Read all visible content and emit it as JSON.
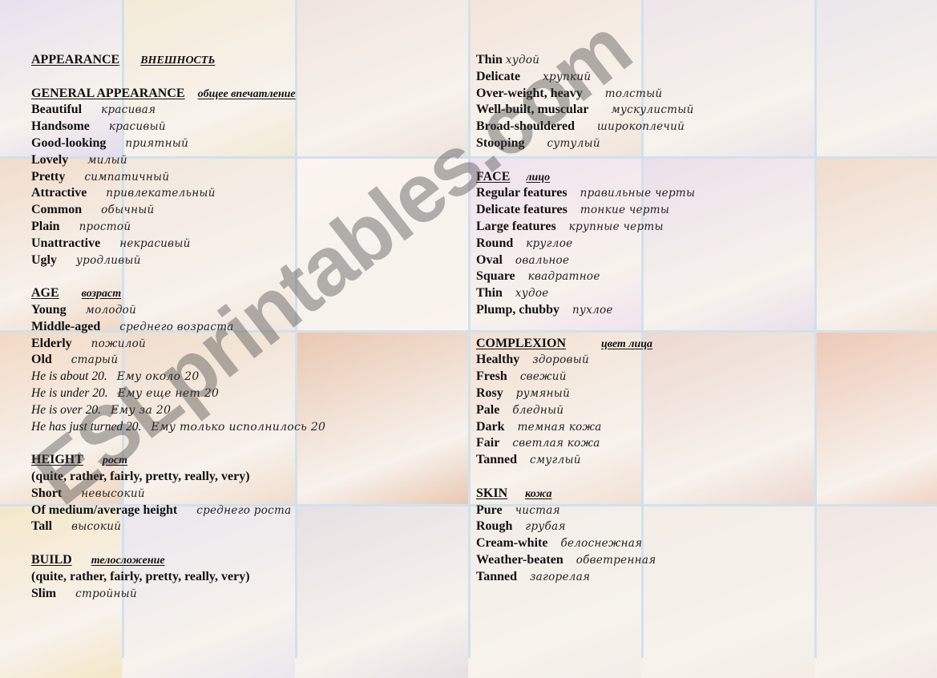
{
  "title": {
    "en": "APPEARANCE",
    "ru": "ВНЕШНОСТЬ"
  },
  "sections_left": [
    {
      "heading": {
        "en": "GENERAL APPEARANCE",
        "ru": "общее впечатление"
      },
      "items": [
        {
          "en": "Beautiful",
          "ru": "красивая"
        },
        {
          "en": "Handsome",
          "ru": "красивый"
        },
        {
          "en": "Good-looking",
          "ru": "приятный"
        },
        {
          "en": "Lovely",
          "ru": "милый"
        },
        {
          "en": "Pretty",
          "ru": "симпатичный"
        },
        {
          "en": "Attractive",
          "ru": "привлекательный"
        },
        {
          "en": "Common",
          "ru": "обычный"
        },
        {
          "en": "Plain",
          "ru": "простой"
        },
        {
          "en": "Unattractive",
          "ru": "некрасивый"
        },
        {
          "en": "Ugly",
          "ru": "уродливый"
        }
      ]
    },
    {
      "heading": {
        "en": "AGE",
        "ru": "возраст"
      },
      "items": [
        {
          "en": "Young",
          "ru": "молодой"
        },
        {
          "en": "Middle-aged",
          "ru": "среднего возраста"
        },
        {
          "en": "Elderly",
          "ru": "пожилой"
        },
        {
          "en": "Old",
          "ru": "старый"
        }
      ],
      "sentences": [
        {
          "en": "He is about 20.",
          "ru": "Ему около 20"
        },
        {
          "en": "He is under 20.",
          "ru": "Ему еще нет 20"
        },
        {
          "en": "He is over 20.",
          "ru": "Ему за 20"
        },
        {
          "en": "He has just turned 20.",
          "ru": "Ему только исполнилось 20"
        }
      ]
    },
    {
      "heading": {
        "en": "HEIGHT",
        "ru": "рост"
      },
      "note": "(quite, rather, fairly, pretty, really, very)",
      "items": [
        {
          "en": "Short",
          "ru": "невысокий"
        },
        {
          "en": "Of medium/average height",
          "ru": "среднего роста"
        },
        {
          "en": "Tall",
          "ru": "высокий"
        }
      ]
    },
    {
      "heading": {
        "en": "BUILD",
        "ru": "телосложение"
      },
      "note": "(quite, rather, fairly, pretty, really, very)",
      "items": [
        {
          "en": "Slim",
          "ru": "стройный"
        }
      ]
    }
  ],
  "build_continued": [
    {
      "en": "Thin",
      "ru": "худой"
    },
    {
      "en": "Delicate",
      "ru": "хрупкий"
    },
    {
      "en": "Over-weight, heavy",
      "ru": "толстый"
    },
    {
      "en": "Well-built, muscular",
      "ru": "мускулистый"
    },
    {
      "en": "Broad-shouldered",
      "ru": "широкоплечий"
    },
    {
      "en": "Stooping",
      "ru": "сутулый"
    }
  ],
  "sections_right": [
    {
      "heading": {
        "en": "FACE",
        "ru": "лицо"
      },
      "items": [
        {
          "en": "Regular features",
          "ru": "правильные черты"
        },
        {
          "en": "Delicate features",
          "ru": "тонкие черты"
        },
        {
          "en": "Large features",
          "ru": "крупные черты"
        },
        {
          "en": "Round",
          "ru": "круглое"
        },
        {
          "en": "Oval",
          "ru": "овальное"
        },
        {
          "en": "Square",
          "ru": "квадратное"
        },
        {
          "en": "Thin",
          "ru": "худое"
        },
        {
          "en": "Plump, chubby",
          "ru": "пухлое"
        }
      ]
    },
    {
      "heading": {
        "en": "COMPLEXION",
        "ru": "цвет лица"
      },
      "items": [
        {
          "en": "Healthy",
          "ru": "здоровый"
        },
        {
          "en": "Fresh",
          "ru": "свежий"
        },
        {
          "en": "Rosy",
          "ru": "румяный"
        },
        {
          "en": "Pale",
          "ru": "бледный"
        },
        {
          "en": "Dark",
          "ru": "темная кожа"
        },
        {
          "en": "Fair",
          "ru": "светлая кожа"
        },
        {
          "en": "Tanned",
          "ru": "смуглый"
        }
      ]
    },
    {
      "heading": {
        "en": "SKIN",
        "ru": "кожа"
      },
      "items": [
        {
          "en": "Pure",
          "ru": "чистая"
        },
        {
          "en": "Rough",
          "ru": "грубая"
        },
        {
          "en": "Cream-white",
          "ru": "белоснежная"
        },
        {
          "en": "Weather-beaten",
          "ru": "обветренная"
        },
        {
          "en": "Tanned",
          "ru": "загорелая"
        }
      ]
    }
  ],
  "watermark": "ESLprintables.com",
  "background_tile_colors": [
    "#e4dcef",
    "#f3ead4",
    "#efe3dc",
    "#f2e3d8",
    "#ece4e8",
    "#e9e5ea",
    "#f0d9c6",
    "#f2e7dd",
    "#fbf4f0",
    "#f0e2ee",
    "#eae0ea",
    "#f0dccd",
    "#f1d6bf",
    "#f0ddcb",
    "#e9c8b2",
    "#f2e0d2",
    "#ecd8d0",
    "#edc9b6",
    "#f4e6c5",
    "#eae6ee",
    "#e6e0e4",
    "#f2ede8",
    "#f3ede6",
    "#efe6e4"
  ]
}
